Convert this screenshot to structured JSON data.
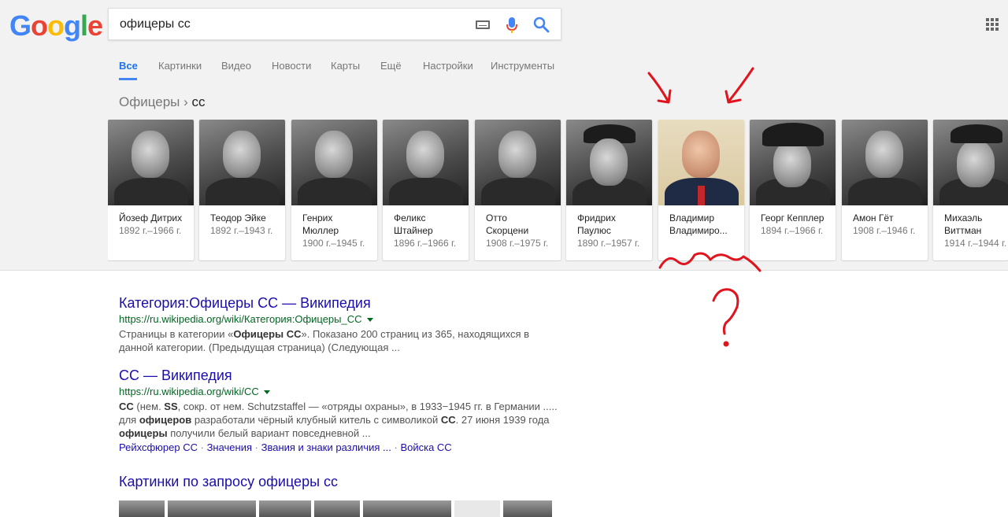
{
  "logo": {
    "letters": [
      "G",
      "o",
      "o",
      "g",
      "l",
      "e"
    ],
    "colors": [
      "#4285f4",
      "#ea4335",
      "#fbbc05",
      "#4285f4",
      "#34a853",
      "#ea4335"
    ]
  },
  "search": {
    "query": "офицеры сс"
  },
  "tabs": [
    {
      "label": "Все",
      "active": true
    },
    {
      "label": "Картинки"
    },
    {
      "label": "Видео"
    },
    {
      "label": "Новости"
    },
    {
      "label": "Карты"
    },
    {
      "label": "Ещё"
    },
    {
      "label": "Настройки"
    },
    {
      "label": "Инструменты"
    }
  ],
  "breadcrumb": {
    "parent": "Офицеры",
    "sep": "›",
    "current": "сс"
  },
  "carousel": [
    {
      "name": "Йозеф Дитрих",
      "dates": "1892 г.–1966 г."
    },
    {
      "name": "Теодор Эйке",
      "dates": "1892 г.–1943 г."
    },
    {
      "name": "Генрих Мюллер",
      "dates": "1900 г.–1945 г."
    },
    {
      "name": "Феликс Штайнер",
      "dates": "1896 г.–1966 г."
    },
    {
      "name": "Отто Скорцени",
      "dates": "1908 г.–1975 г."
    },
    {
      "name": "Фридрих Паулюс",
      "dates": "1890 г.–1957 г."
    },
    {
      "name": "Владимир Владимиро...",
      "dates": ""
    },
    {
      "name": "Георг Кепплер",
      "dates": "1894 г.–1966 г."
    },
    {
      "name": "Амон Гёт",
      "dates": "1908 г.–1946 г."
    },
    {
      "name": "Михаэль Виттман",
      "dates": "1914 г.–1944 г."
    }
  ],
  "annotation": {
    "question_mark": "?",
    "color": "#e0141e"
  },
  "results": [
    {
      "title": "Категория:Офицеры СС — Википедия",
      "url": "https://ru.wikipedia.org/wiki/Категория:Офицеры_СС",
      "snippet_parts": [
        {
          "t": "Страницы в категории «"
        },
        {
          "t": "Офицеры СС",
          "b": true
        },
        {
          "t": "». Показано 200 страниц из 365, находящихся в данной категории. (Предыдущая страница) (Следующая ..."
        }
      ]
    },
    {
      "title": "СС — Википедия",
      "url": "https://ru.wikipedia.org/wiki/СС",
      "snippet_parts": [
        {
          "t": "СС",
          "b": true
        },
        {
          "t": " (нем. "
        },
        {
          "t": "SS",
          "b": true
        },
        {
          "t": ", сокр. от нем. Schutzstaffel — «отряды охраны», в 1933−1945 гг. в Германии ..... для "
        },
        {
          "t": "офицеров",
          "b": true
        },
        {
          "t": " разработали чёрный клубный китель с символикой "
        },
        {
          "t": "СС",
          "b": true
        },
        {
          "t": ". 27 июня 1939 года "
        },
        {
          "t": "офицеры",
          "b": true
        },
        {
          "t": " получили белый вариант повседневной ..."
        }
      ],
      "sublinks": [
        "Рейхсфюрер СС",
        "Значения",
        "Звания и знаки различия ...",
        "Войска СС"
      ]
    }
  ],
  "images_heading": "Картинки по запросу офицеры сс"
}
